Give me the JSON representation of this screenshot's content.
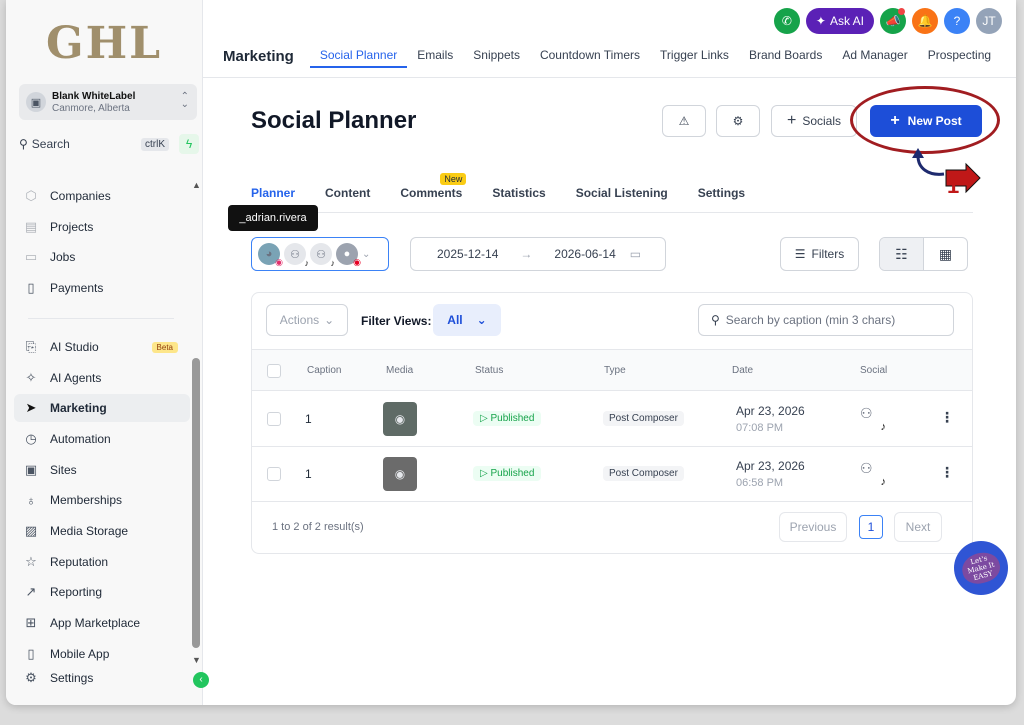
{
  "brand": {
    "logo_text": "GHL"
  },
  "account": {
    "name": "Blank WhiteLabel",
    "location": "Canmore, Alberta"
  },
  "search": {
    "label": "Search",
    "shortcut": "ctrlK"
  },
  "sidebar": {
    "items": [
      {
        "label": "Companies",
        "icon": "building-icon"
      },
      {
        "label": "Projects",
        "icon": "folder-icon"
      },
      {
        "label": "Jobs",
        "icon": "briefcase-icon"
      },
      {
        "label": "Payments",
        "icon": "receipt-icon"
      },
      {
        "label": "AI Studio",
        "icon": "ai-studio-icon",
        "badge": "Beta"
      },
      {
        "label": "AI Agents",
        "icon": "sparkle-icon"
      },
      {
        "label": "Marketing",
        "icon": "send-icon",
        "active": true
      },
      {
        "label": "Automation",
        "icon": "play-circle-icon"
      },
      {
        "label": "Sites",
        "icon": "sites-icon"
      },
      {
        "label": "Memberships",
        "icon": "medal-icon"
      },
      {
        "label": "Media Storage",
        "icon": "image-icon"
      },
      {
        "label": "Reputation",
        "icon": "star-icon"
      },
      {
        "label": "Reporting",
        "icon": "trend-icon"
      },
      {
        "label": "App Marketplace",
        "icon": "grid-icon"
      },
      {
        "label": "Mobile App",
        "icon": "phone-icon"
      },
      {
        "label": "Settings",
        "icon": "gear-icon"
      }
    ]
  },
  "topbar": {
    "ask_ai": "Ask AI",
    "user_initials": "JT",
    "section_title": "Marketing",
    "tabs": [
      "Social Planner",
      "Emails",
      "Snippets",
      "Countdown Timers",
      "Trigger Links",
      "Brand Boards",
      "Ad Manager",
      "Prospecting"
    ]
  },
  "page": {
    "title": "Social Planner",
    "socials_button": "Socials",
    "new_post_button": "New Post",
    "annotation_number": "1",
    "subtabs": [
      "Planner",
      "Content",
      "Comments",
      "Statistics",
      "Social Listening",
      "Settings"
    ],
    "new_badge": "New",
    "tooltip": "_adrian.rivera",
    "date_from": "2025-12-14",
    "date_to": "2026-06-14",
    "filters_button": "Filters"
  },
  "table": {
    "actions_label": "Actions",
    "filter_views_label": "Filter Views:",
    "filter_views_value": "All",
    "search_placeholder": "Search by caption (min 3 chars)",
    "columns": [
      "Caption",
      "Media",
      "Status",
      "Type",
      "Date",
      "Social"
    ],
    "rows": [
      {
        "caption": "1",
        "status": "Published",
        "type": "Post Composer",
        "date": "Apr 23, 2026",
        "time": "07:08 PM"
      },
      {
        "caption": "1",
        "status": "Published",
        "type": "Post Composer",
        "date": "Apr 23, 2026",
        "time": "06:58 PM"
      }
    ],
    "result_text": "1 to 2 of 2 result(s)",
    "prev_label": "Previous",
    "page_number": "1",
    "next_label": "Next"
  },
  "helper_widget": {
    "text": "Let's Make It EASY"
  },
  "colors": {
    "primary": "#1d4ed8",
    "annotation": "#a11d21",
    "published": "#16a34a"
  }
}
